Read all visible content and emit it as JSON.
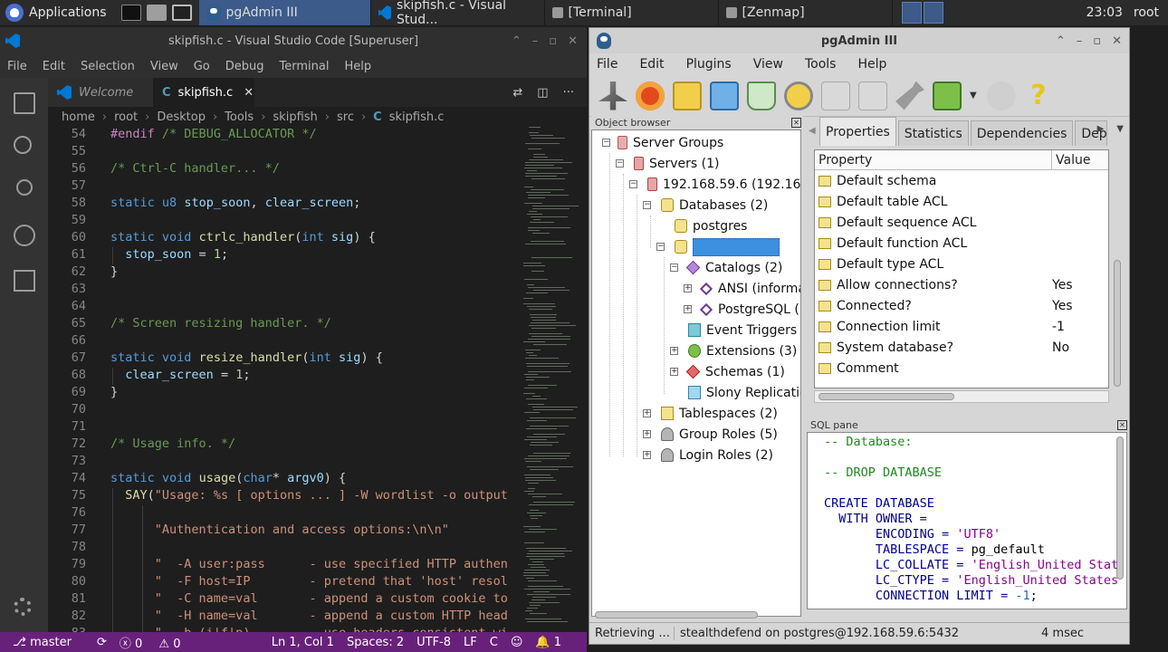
{
  "taskbar": {
    "applications_label": "Applications",
    "tasks": [
      {
        "label": "pgAdmin III"
      },
      {
        "label": "skipfish.c - Visual Stud..."
      },
      {
        "label": "[Terminal]"
      },
      {
        "label": "[Zenmap]"
      }
    ],
    "clock": "23:03",
    "user": "root"
  },
  "vscode": {
    "title": "skipfish.c - Visual Studio Code [Superuser]",
    "menu": [
      "File",
      "Edit",
      "Selection",
      "View",
      "Go",
      "Debug",
      "Terminal",
      "Help"
    ],
    "tabs": [
      {
        "label": "Welcome"
      },
      {
        "label": "skipfish.c",
        "icon": "C"
      }
    ],
    "breadcrumb": [
      "home",
      "root",
      "Desktop",
      "Tools",
      "skipfish",
      "src",
      "skipfish.c"
    ],
    "code_lines": [
      {
        "n": "54",
        "text": "#endif /* DEBUG_ALLOCATOR */"
      },
      {
        "n": "55",
        "text": ""
      },
      {
        "n": "56",
        "text": "/* Ctrl-C handler... */"
      },
      {
        "n": "57",
        "text": ""
      },
      {
        "n": "58",
        "text": "static u8 stop_soon, clear_screen;"
      },
      {
        "n": "59",
        "text": ""
      },
      {
        "n": "60",
        "text": "static void ctrlc_handler(int sig) {"
      },
      {
        "n": "61",
        "text": "  stop_soon = 1;"
      },
      {
        "n": "62",
        "text": "}"
      },
      {
        "n": "63",
        "text": ""
      },
      {
        "n": "64",
        "text": ""
      },
      {
        "n": "65",
        "text": "/* Screen resizing handler. */"
      },
      {
        "n": "66",
        "text": ""
      },
      {
        "n": "67",
        "text": "static void resize_handler(int sig) {"
      },
      {
        "n": "68",
        "text": "  clear_screen = 1;"
      },
      {
        "n": "69",
        "text": "}"
      },
      {
        "n": "70",
        "text": ""
      },
      {
        "n": "71",
        "text": ""
      },
      {
        "n": "72",
        "text": "/* Usage info. */"
      },
      {
        "n": "73",
        "text": ""
      },
      {
        "n": "74",
        "text": "static void usage(char* argv0) {"
      },
      {
        "n": "75",
        "text": "  SAY(\"Usage: %s [ options ... ] -W wordlist -o output"
      },
      {
        "n": "76",
        "text": ""
      },
      {
        "n": "77",
        "text": "      \"Authentication and access options:\\n\\n\""
      },
      {
        "n": "78",
        "text": ""
      },
      {
        "n": "79",
        "text": "      \"  -A user:pass      - use specified HTTP authen"
      },
      {
        "n": "80",
        "text": "      \"  -F host=IP        - pretend that 'host' resol"
      },
      {
        "n": "81",
        "text": "      \"  -C name=val       - append a custom cookie to"
      },
      {
        "n": "82",
        "text": "      \"  -H name=val       - append a custom HTTP head"
      },
      {
        "n": "83",
        "text": "      \"  -b (i|f|p)        - use headers consistent wi"
      }
    ],
    "status": {
      "branch": "master",
      "errors": "0",
      "warnings": "0",
      "position": "Ln 1, Col 1",
      "spaces": "Spaces: 2",
      "encoding": "UTF-8",
      "eol": "LF",
      "language": "C",
      "notifications": "1"
    }
  },
  "pgadmin": {
    "title": "pgAdmin III",
    "menu": [
      "File",
      "Edit",
      "Plugins",
      "View",
      "Tools",
      "Help"
    ],
    "object_browser_title": "Object browser",
    "tree": [
      {
        "label": "Server Groups",
        "depth": 0,
        "exp": "minus",
        "icon": "none"
      },
      {
        "label": "Servers (1)",
        "depth": 1,
        "exp": "minus",
        "icon": "server"
      },
      {
        "label": "192.168.59.6 (192.168",
        "depth": 2,
        "exp": "minus",
        "icon": "server"
      },
      {
        "label": "Databases (2)",
        "depth": 3,
        "exp": "minus",
        "icon": "db"
      },
      {
        "label": "postgres",
        "depth": 4,
        "exp": "none",
        "icon": "db"
      },
      {
        "label": "",
        "depth": 4,
        "exp": "minus",
        "icon": "db",
        "selected": true
      },
      {
        "label": "Catalogs (2)",
        "depth": 5,
        "exp": "minus",
        "icon": "cat"
      },
      {
        "label": "ANSI (informa",
        "depth": 6,
        "exp": "plus",
        "icon": "cat2"
      },
      {
        "label": "PostgreSQL (p",
        "depth": 6,
        "exp": "plus",
        "icon": "cat2"
      },
      {
        "label": "Event Triggers (",
        "depth": 5,
        "exp": "none",
        "icon": "trig"
      },
      {
        "label": "Extensions (3)",
        "depth": 5,
        "exp": "plus",
        "icon": "ext"
      },
      {
        "label": "Schemas (1)",
        "depth": 5,
        "exp": "plus",
        "icon": "schema"
      },
      {
        "label": "Slony Replicatio",
        "depth": 5,
        "exp": "none",
        "icon": "slony"
      },
      {
        "label": "Tablespaces (2)",
        "depth": 3,
        "exp": "plus",
        "icon": "ts"
      },
      {
        "label": "Group Roles (5)",
        "depth": 3,
        "exp": "plus",
        "icon": "role"
      },
      {
        "label": "Login Roles (2)",
        "depth": 3,
        "exp": "plus",
        "icon": "role"
      }
    ],
    "props_tabs": [
      "Properties",
      "Statistics",
      "Dependencies",
      "Dep"
    ],
    "props_header": {
      "property": "Property",
      "value": "Value"
    },
    "props_rows": [
      {
        "name": "Default schema",
        "value": ""
      },
      {
        "name": "Default table ACL",
        "value": ""
      },
      {
        "name": "Default sequence ACL",
        "value": ""
      },
      {
        "name": "Default function ACL",
        "value": ""
      },
      {
        "name": "Default type ACL",
        "value": ""
      },
      {
        "name": "Allow connections?",
        "value": "Yes"
      },
      {
        "name": "Connected?",
        "value": "Yes"
      },
      {
        "name": "Connection limit",
        "value": "-1"
      },
      {
        "name": "System database?",
        "value": "No"
      },
      {
        "name": "Comment",
        "value": ""
      }
    ],
    "sql_pane_title": "SQL pane",
    "sql_lines": [
      [
        {
          "t": "-- Database:",
          "c": "cmt"
        }
      ],
      [
        {
          "t": "",
          "c": ""
        }
      ],
      [
        {
          "t": "-- DROP DATABASE",
          "c": "cmt"
        }
      ],
      [
        {
          "t": "",
          "c": ""
        }
      ],
      [
        {
          "t": "CREATE DATABASE",
          "c": "kw"
        }
      ],
      [
        {
          "t": "  WITH OWNER = ",
          "c": "kw"
        }
      ],
      [
        {
          "t": "       ENCODING = ",
          "c": "kw"
        },
        {
          "t": "'UTF8'",
          "c": "str"
        }
      ],
      [
        {
          "t": "       TABLESPACE = ",
          "c": "kw"
        },
        {
          "t": "pg_default",
          "c": ""
        }
      ],
      [
        {
          "t": "       LC_COLLATE = ",
          "c": "kw"
        },
        {
          "t": "'English_United Stat",
          "c": "str"
        }
      ],
      [
        {
          "t": "       LC_CTYPE = ",
          "c": "kw"
        },
        {
          "t": "'English_United States",
          "c": "str"
        }
      ],
      [
        {
          "t": "       CONNECTION LIMIT = ",
          "c": "kw"
        },
        {
          "t": "-1",
          "c": "num"
        },
        {
          "t": ";",
          "c": ""
        }
      ]
    ],
    "status": {
      "left": "Retrieving ...",
      "middle": "stealthdefend on postgres@192.168.59.6:5432",
      "right": "4 msec"
    }
  }
}
